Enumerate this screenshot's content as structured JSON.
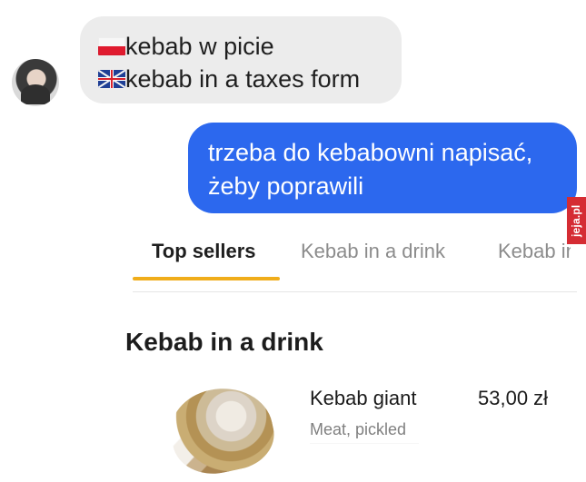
{
  "chat": {
    "incoming": {
      "lines": [
        "kebab w picie",
        "kebab in a taxes form"
      ],
      "flags": [
        "poland-flag-icon",
        "uk-flag-icon"
      ]
    },
    "outgoing": {
      "lines": [
        "trzeba do kebabowni napisać,",
        "żeby poprawili"
      ]
    }
  },
  "watermark": {
    "text": "jeja.pl",
    "color": "#d52c33"
  },
  "menu": {
    "tabs": [
      "Top sellers",
      "Kebab in a drink",
      "Kebab in"
    ],
    "active_tab": "Top sellers",
    "active_tab_color": "#f0ad1a",
    "section_title": "Kebab in a drink",
    "item": {
      "name": "Kebab giant",
      "price": "53,00 zł",
      "description": "Meat, pickled"
    }
  },
  "colors": {
    "incoming_bubble": "#ececec",
    "outgoing_bubble": "#2c68ee"
  }
}
